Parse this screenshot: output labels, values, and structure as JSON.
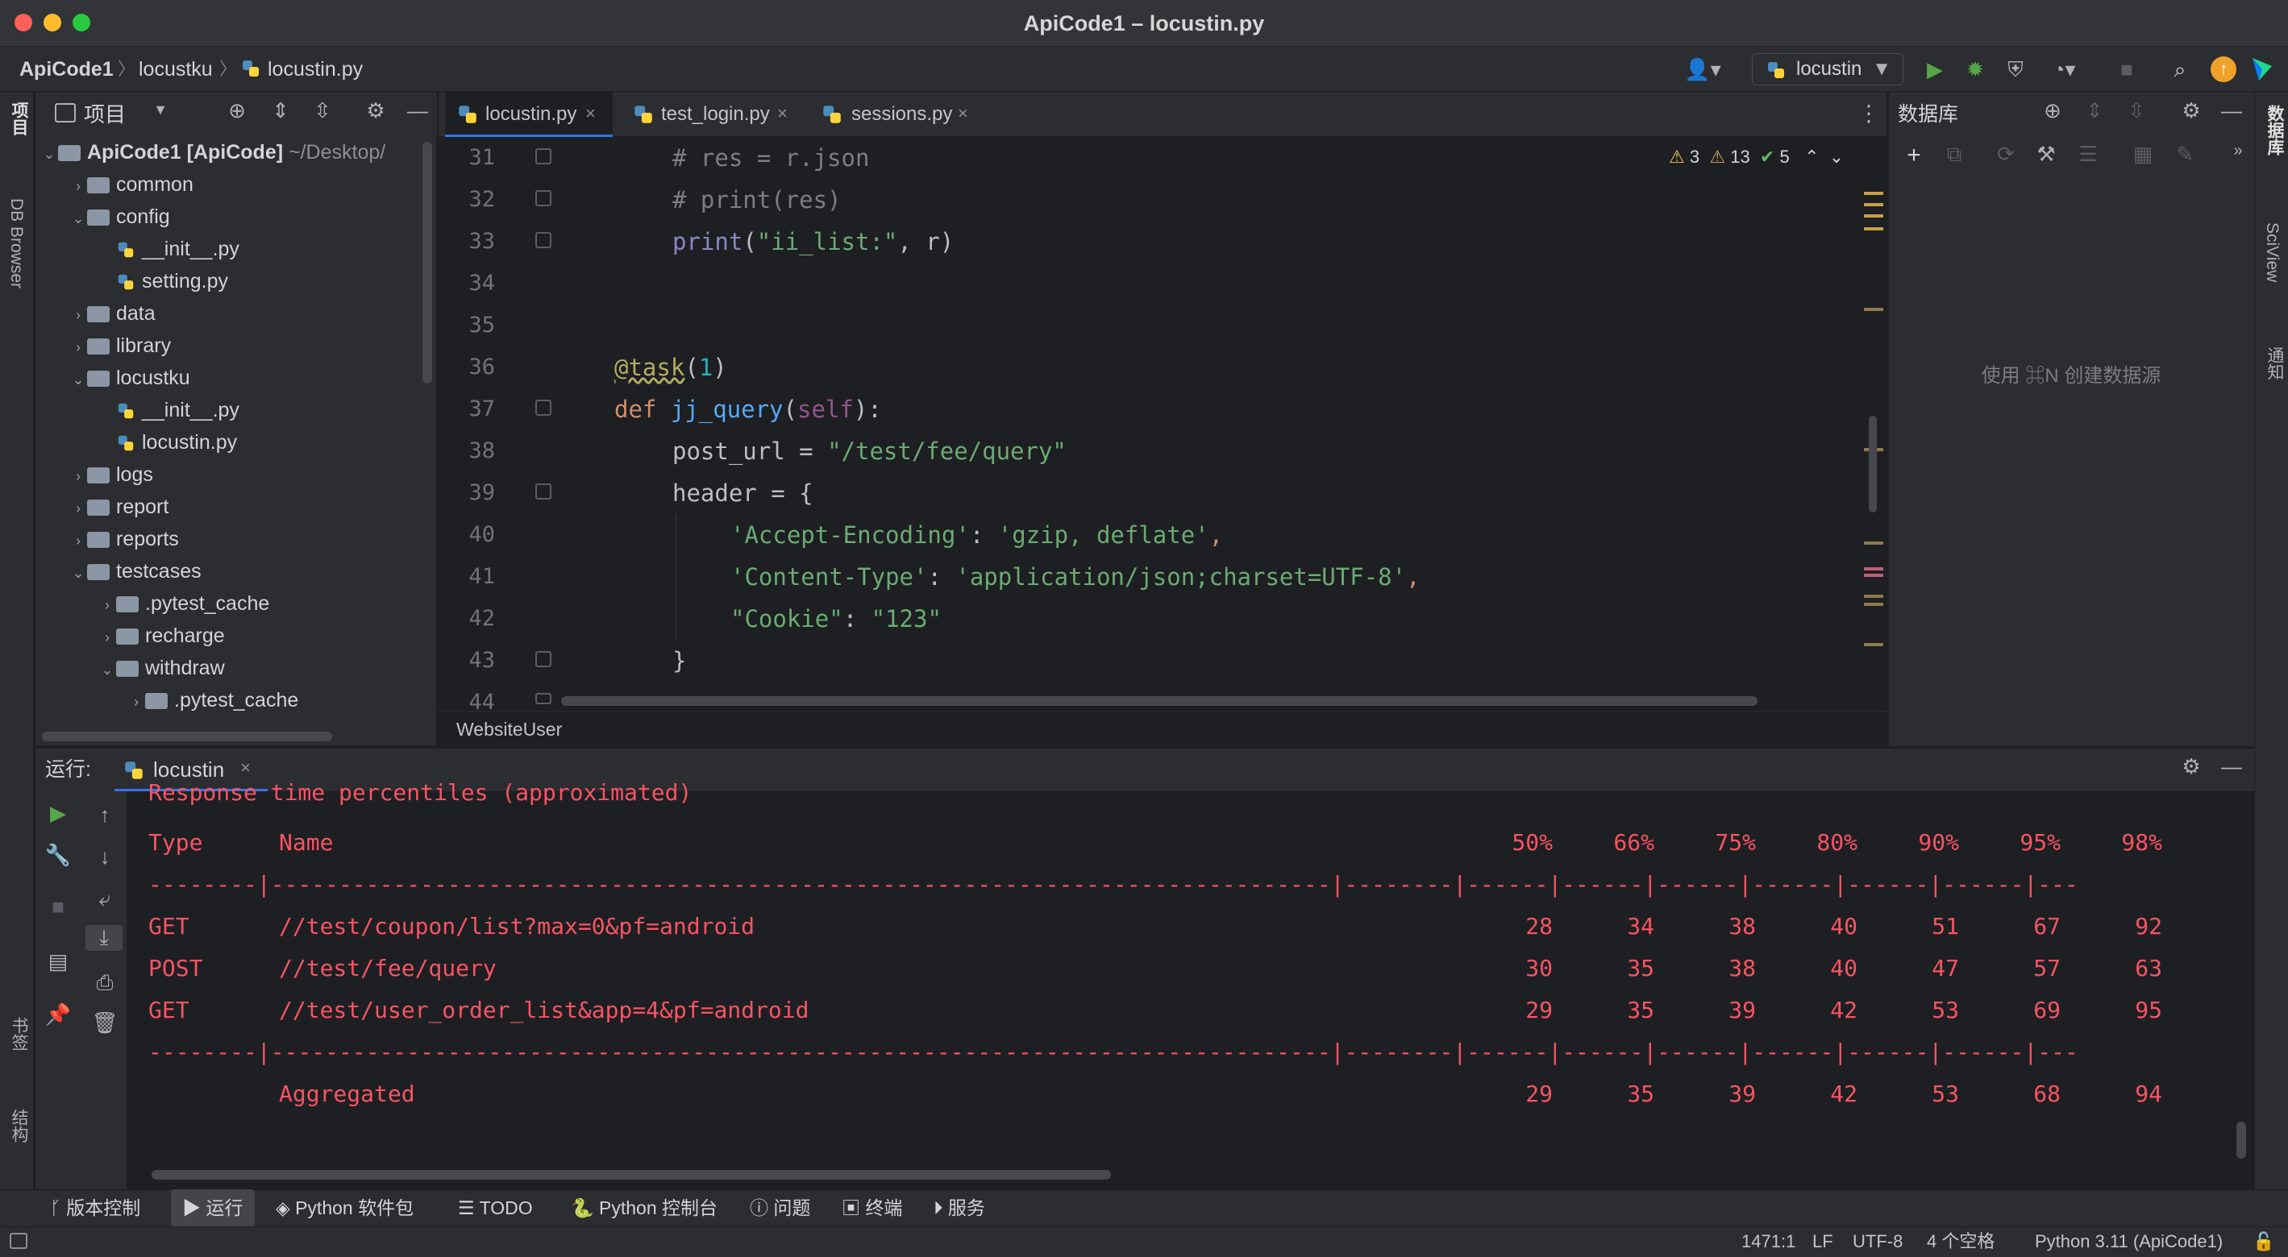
{
  "window": {
    "title": "ApiCode1 – locustin.py"
  },
  "nav": {
    "crumbs": [
      "ApiCode1",
      "locustku",
      "locustin.py"
    ],
    "run_config": "locustin"
  },
  "project_panel": {
    "title": "项目",
    "root": "ApiCode1 [ApiCode]",
    "root_path": "~/Desktop/",
    "items": [
      {
        "label": "common",
        "type": "folder",
        "depth": 1,
        "expanded": false
      },
      {
        "label": "config",
        "type": "folder",
        "depth": 1,
        "expanded": true
      },
      {
        "label": "__init__.py",
        "type": "file",
        "depth": 2
      },
      {
        "label": "setting.py",
        "type": "file",
        "depth": 2
      },
      {
        "label": "data",
        "type": "folder",
        "depth": 1,
        "expanded": false
      },
      {
        "label": "library",
        "type": "folder",
        "depth": 1,
        "expanded": false
      },
      {
        "label": "locustku",
        "type": "folder",
        "depth": 1,
        "expanded": true
      },
      {
        "label": "__init__.py",
        "type": "file",
        "depth": 2
      },
      {
        "label": "locustin.py",
        "type": "file",
        "depth": 2
      },
      {
        "label": "logs",
        "type": "folder",
        "depth": 1,
        "expanded": false
      },
      {
        "label": "report",
        "type": "folder",
        "depth": 1,
        "expanded": false
      },
      {
        "label": "reports",
        "type": "folder",
        "depth": 1,
        "expanded": false
      },
      {
        "label": "testcases",
        "type": "folder",
        "depth": 1,
        "expanded": true
      },
      {
        "label": ".pytest_cache",
        "type": "folder",
        "depth": 2,
        "expanded": false
      },
      {
        "label": "recharge",
        "type": "folder",
        "depth": 2,
        "expanded": false
      },
      {
        "label": "withdraw",
        "type": "folder",
        "depth": 2,
        "expanded": true
      },
      {
        "label": ".pytest_cache",
        "type": "folder",
        "depth": 3,
        "expanded": false
      }
    ]
  },
  "left_strip": {
    "project": "项目",
    "db_browser": "DB Browser",
    "bookmarks": "书签",
    "structure": "结构"
  },
  "editor": {
    "tabs": [
      {
        "label": "locustin.py",
        "active": true
      },
      {
        "label": "test_login.py",
        "active": false
      },
      {
        "label": "sessions.py",
        "active": false
      }
    ],
    "inspections": {
      "warnings": "3",
      "weak_warnings": "13",
      "ok": "5"
    },
    "line_numbers": [
      "31",
      "32",
      "33",
      "34",
      "35",
      "36",
      "37",
      "38",
      "39",
      "40",
      "41",
      "42",
      "43",
      "44"
    ],
    "lines": {
      "l31": "# res = r.json",
      "l32": "# print(res)",
      "l33_fn": "print",
      "l33_open": "(",
      "l33_str": "\"ii_list:\"",
      "l33_rest": ", r)",
      "l36_deco": "@task",
      "l36_open": "(",
      "l36_num": "1",
      "l36_close": ")",
      "l37_kw": "def ",
      "l37_fn": "jj_query",
      "l37_open": "(",
      "l37_self": "self",
      "l37_close": "):",
      "l38_var": "post_url = ",
      "l38_str": "\"/test/fee/query\"",
      "l39": "header = {",
      "l40_k": "'Accept-Encoding'",
      "l40_c": ": ",
      "l40_v": "'gzip, deflate'",
      "l40_e": ",",
      "l41_k": "'Content-Type'",
      "l41_c": ": ",
      "l41_v": "'application/json;charset=UTF-8'",
      "l41_e": ",",
      "l42_k": "\"Cookie\"",
      "l42_c": ": ",
      "l42_v": "\"123\"",
      "l43": "}"
    },
    "breadcrumb": "WebsiteUser"
  },
  "db_panel": {
    "title": "数据库",
    "empty_hint": "使用 ⌘N 创建数据源"
  },
  "right_strip": {
    "database": "数据库",
    "sciview": "SciView",
    "notifications": "通知"
  },
  "run": {
    "label": "运行:",
    "tab": "locustin",
    "console": {
      "partial_top": "Response time percentiles (approximated)",
      "header_type": "Type",
      "header_name": "Name",
      "percentiles": [
        "50%",
        "66%",
        "75%",
        "80%",
        "90%",
        "95%",
        "98%"
      ],
      "separator": "--------|------------------------------------------------------------------------------|--------|------|------|------|------|------|------|---",
      "rows": [
        {
          "type": "GET",
          "name": "//test/coupon/list?max=0&pf=android",
          "values": [
            "28",
            "34",
            "38",
            "40",
            "51",
            "67",
            "92"
          ]
        },
        {
          "type": "POST",
          "name": "//test/fee/query",
          "values": [
            "30",
            "35",
            "38",
            "40",
            "47",
            "57",
            "63"
          ]
        },
        {
          "type": "GET",
          "name": "//test/user_order_list&app=4&pf=android",
          "values": [
            "29",
            "35",
            "39",
            "42",
            "53",
            "69",
            "95"
          ]
        }
      ],
      "aggregated": {
        "name": "Aggregated",
        "values": [
          "29",
          "35",
          "39",
          "42",
          "53",
          "68",
          "94"
        ]
      }
    }
  },
  "bottom_tools": [
    "版本控制",
    "运行",
    "Python 软件包",
    "TODO",
    "Python 控制台",
    "问题",
    "终端",
    "服务"
  ],
  "status": {
    "position": "1471:1",
    "line_sep": "LF",
    "encoding": "UTF-8",
    "indent": "4 个空格",
    "interpreter": "Python 3.11 (ApiCode1)"
  }
}
